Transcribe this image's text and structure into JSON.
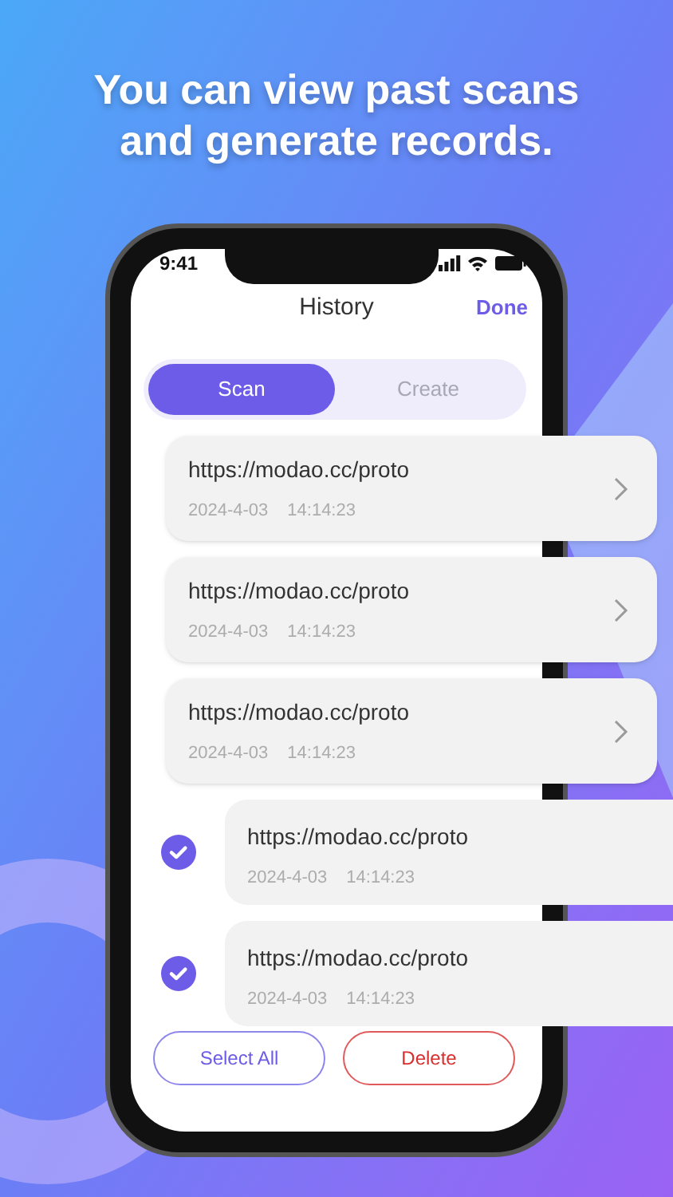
{
  "headline": [
    "You can view past scans",
    "and generate records."
  ],
  "status_bar": {
    "time": "9:41"
  },
  "nav": {
    "title": "History",
    "action": "Done"
  },
  "tabs": [
    {
      "label": "Scan",
      "selected": true
    },
    {
      "label": "Create",
      "selected": false
    }
  ],
  "records": [
    {
      "url": "https://modao.cc/proto",
      "date": "2024-4-03",
      "time": "14:14:23",
      "checked": false
    },
    {
      "url": "https://modao.cc/proto",
      "date": "2024-4-03",
      "time": "14:14:23",
      "checked": false
    },
    {
      "url": "https://modao.cc/proto",
      "date": "2024-4-03",
      "time": "14:14:23",
      "checked": false
    },
    {
      "url": "https://modao.cc/proto",
      "date": "2024-4-03",
      "time": "14:14:23",
      "checked": true
    },
    {
      "url": "https://modao.cc/proto",
      "date": "2024-4-03",
      "time": "14:14:23",
      "checked": true
    }
  ],
  "buttons": {
    "select_all": "Select All",
    "delete": "Delete"
  }
}
